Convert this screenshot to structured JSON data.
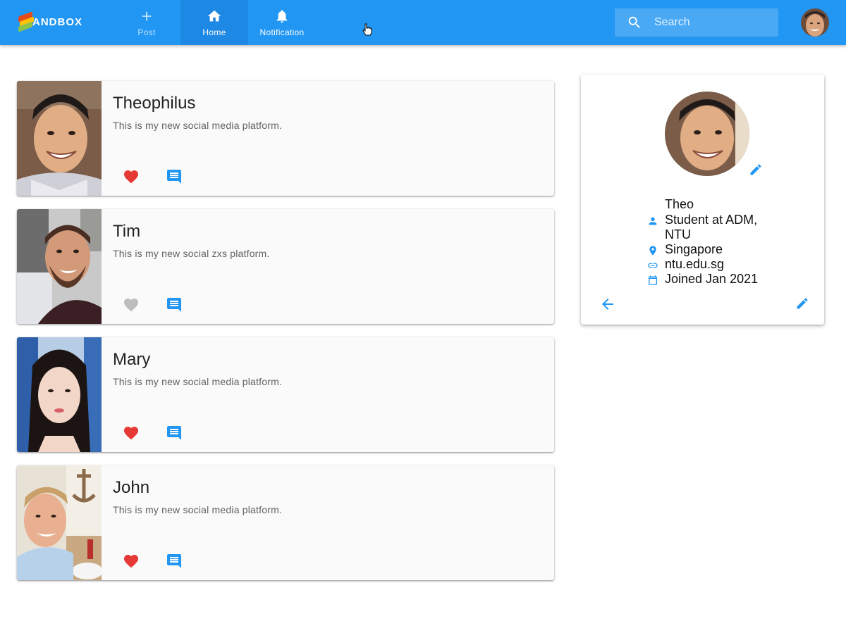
{
  "header": {
    "logo_text": "ANDBOX",
    "nav": [
      {
        "label": "Post",
        "icon": "plus-icon"
      },
      {
        "label": "Home",
        "icon": "home-icon"
      },
      {
        "label": "Notification",
        "icon": "bell-icon"
      }
    ],
    "search_placeholder": "Search"
  },
  "posts": [
    {
      "name": "Theophilus",
      "body": "This is my new social media platform.",
      "liked": true
    },
    {
      "name": "Tim",
      "body": "This is my new social zxs platform.",
      "liked": false
    },
    {
      "name": "Mary",
      "body": "This is my new social media platform.",
      "liked": true
    },
    {
      "name": "John",
      "body": "This is my new social media platform.",
      "liked": true
    }
  ],
  "profile": {
    "handle": "Theo",
    "bio": "Student at ADM, NTU",
    "location": "Singapore",
    "website": "ntu.edu.sg",
    "joined": "Joined Jan 2021"
  },
  "colors": {
    "primary": "#2196f3",
    "like_active": "#e53935",
    "like_inactive": "#bdbdbd"
  }
}
